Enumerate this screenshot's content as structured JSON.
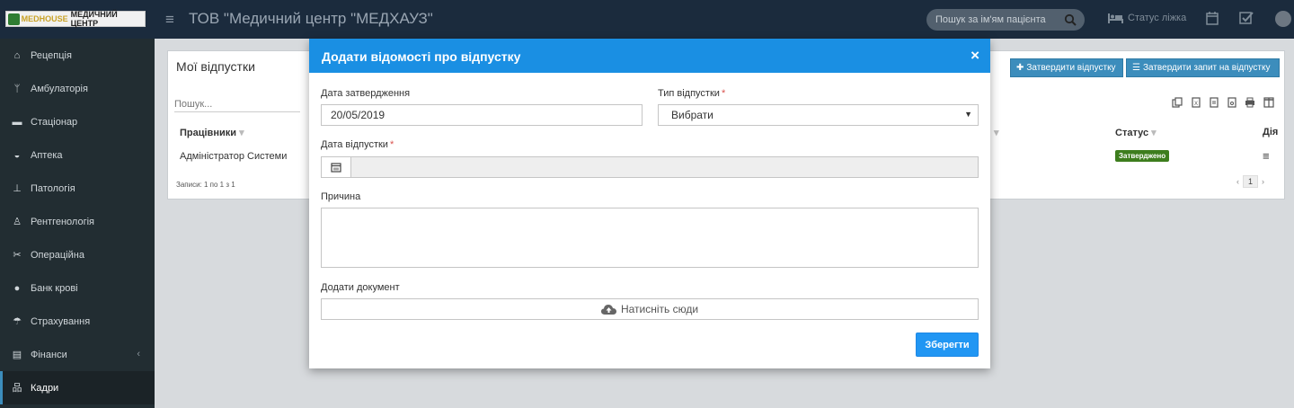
{
  "header": {
    "logo_text_brand": "MEDHOUSE",
    "logo_text": "МЕДИЧНИЙ ЦЕНТР",
    "title": "ТОВ \"Медичний центр \"МЕДХАУЗ\"",
    "search_placeholder": "Пошук за ім'ям пацієнта",
    "bed_status": "Статус ліжка"
  },
  "sidebar": {
    "items": [
      {
        "label": "Рецепція",
        "icon": "reception-icon"
      },
      {
        "label": "Амбулаторія",
        "icon": "stethoscope-icon"
      },
      {
        "label": "Стаціонар",
        "icon": "bed-icon"
      },
      {
        "label": "Аптека",
        "icon": "mortar-icon"
      },
      {
        "label": "Патологія",
        "icon": "microscope-icon"
      },
      {
        "label": "Рентгенологія",
        "icon": "xray-icon"
      },
      {
        "label": "Операційна",
        "icon": "scissors-icon"
      },
      {
        "label": "Банк крові",
        "icon": "blood-drop-icon"
      },
      {
        "label": "Страхування",
        "icon": "umbrella-icon"
      },
      {
        "label": "Фінанси",
        "icon": "money-icon",
        "arrow": "‹"
      },
      {
        "label": "Кадри",
        "icon": "sitemap-icon",
        "active": true
      }
    ]
  },
  "panel": {
    "title": "Мої відпустки",
    "approve_button": "Затвердити відпустку",
    "approve_request_button": "Затвердити запит на відпустку",
    "search_placeholder": "Пошук...",
    "columns": {
      "employees": "Працівники",
      "status": "Статус",
      "action": "Дія"
    },
    "row": {
      "employee": "Адміністратор Системи",
      "status": "Затверджено"
    },
    "records": "Записи: 1 по 1 з 1",
    "page": "1"
  },
  "modal": {
    "title": "Додати відомості про відпустку",
    "close": "×",
    "approval_date_label": "Дата затвердження",
    "approval_date_value": "20/05/2019",
    "leave_type_label": "Тип відпустки",
    "leave_type_value": "Вибрати",
    "leave_date_label": "Дата відпустки",
    "reason_label": "Причина",
    "document_label": "Додати документ",
    "upload_text": "Натисніть сюди",
    "save_button": "Зберегти",
    "required_mark": "*"
  },
  "colors": {
    "accent": "#1a8fe3",
    "sidebar": "#222d32",
    "topbar": "#1b2b3d",
    "approved": "#3d7d1d"
  }
}
